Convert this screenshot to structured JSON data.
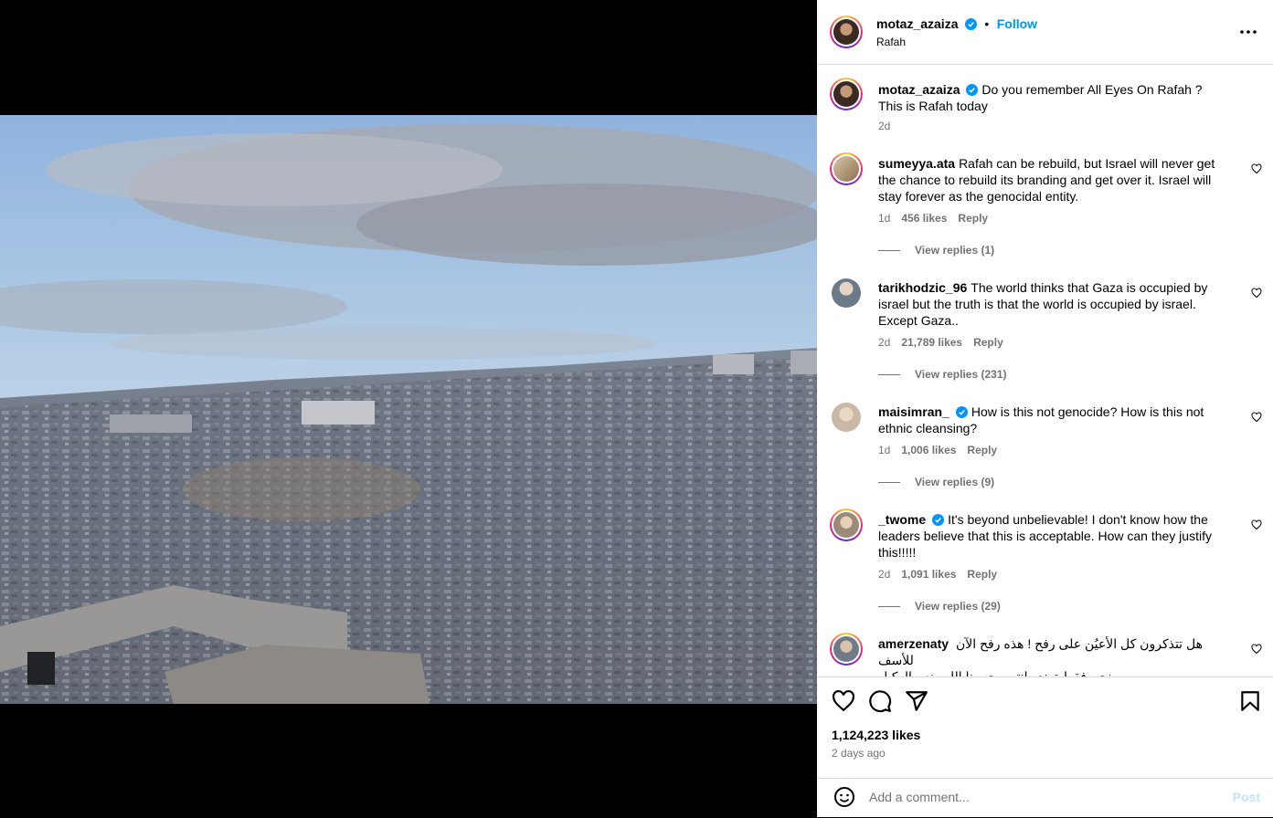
{
  "post": {
    "username": "motaz_azaiza",
    "follow_label": "Follow",
    "separator": "•",
    "location": "Rafah",
    "more_label": "More options",
    "caption_line1": "Do you remember All Eyes On Rafah ?",
    "caption_line2": "This is Rafah today",
    "caption_time": "2d"
  },
  "comments": [
    {
      "username": "sumeyya.ata",
      "text": "Rafah can be rebuild, but Israel will never get the chance to rebuild its branding and get over it. Israel will stay forever as the genocidal entity.",
      "time": "1d",
      "likes": "456 likes",
      "reply": "Reply",
      "view_replies": "View replies (1)"
    },
    {
      "username": "tarikhodzic_96",
      "text": "The world thinks that Gaza is occupied by israel but the truth is that the world is occupied by israel. Except Gaza..",
      "time": "2d",
      "likes": "21,789 likes",
      "reply": "Reply",
      "view_replies": "View replies (231)"
    },
    {
      "username": "maisimran_",
      "text": "How is this not genocide? How is this not ethnic cleansing?",
      "time": "1d",
      "likes": "1,006 likes",
      "reply": "Reply",
      "view_replies": "View replies (9)"
    },
    {
      "username": "_twome",
      "text": "It's beyond unbelievable! I don't know how the leaders believe that this is acceptable. How can they justify this!!!!!",
      "time": "2d",
      "likes": "1,091 likes",
      "reply": "Reply",
      "view_replies": "View replies (29)"
    },
    {
      "username": "amerzenaty",
      "text_line1": "هل تتذكرون كل الأعيُن على رفح ! هذه رفح الآن للأسف",
      "text_line2": "نحن فقط ترند وانتهى حسبنا الله ونعم الوكيل"
    }
  ],
  "actions": {
    "likes": "1,124,223 likes",
    "time_ago": "2 days ago"
  },
  "add_comment": {
    "placeholder": "Add a comment...",
    "post_label": "Post"
  },
  "colors": {
    "accent": "#0095f6",
    "muted": "#737373",
    "border": "#dbdbdb",
    "verified": "#0095f6"
  },
  "icons": [
    "heart-icon",
    "comment-icon",
    "share-icon",
    "bookmark-icon",
    "emoji-icon",
    "more-icon",
    "verified-icon"
  ]
}
